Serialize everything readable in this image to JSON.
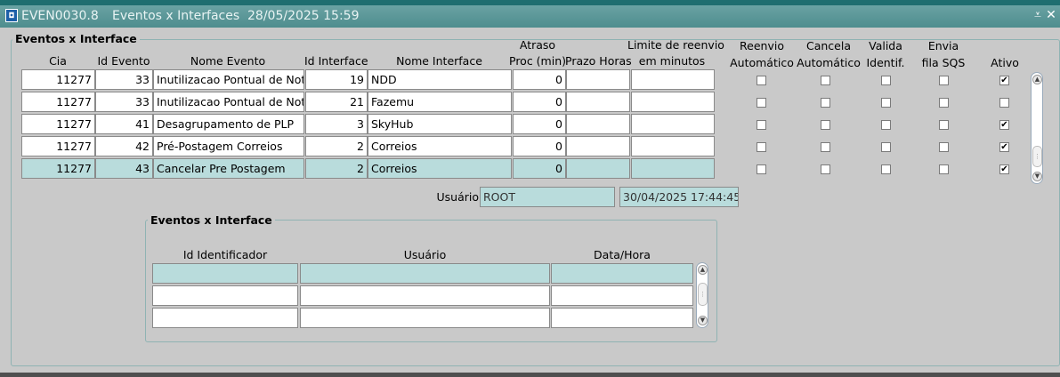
{
  "window": {
    "icon": "form-icon",
    "form_id": "EVEN0030.8",
    "title": "Eventos x Interfaces",
    "datetime": "28/05/2025 15:59",
    "minimize_label": "⩡",
    "close_label": "✕"
  },
  "main": {
    "title": "Eventos x Interface",
    "headers": {
      "cia": "Cia",
      "id_evento": "Id Evento",
      "nome_evento": "Nome Evento",
      "id_interface": "Id Interface",
      "nome_interface": "Nome Interface",
      "atraso_1": "Atraso",
      "atraso_2": "Proc (min)",
      "prazo": "Prazo Horas",
      "limite_1": "Limite de reenvio",
      "limite_2": "em minutos",
      "reenvio_1": "Reenvio",
      "reenvio_2": "Automático",
      "cancela_1": "Cancela",
      "cancela_2": "Automático",
      "valida_1": "Valida",
      "valida_2": "Identif.",
      "envia_1": "Envia",
      "envia_2": "fila SQS",
      "ativo": "Ativo"
    },
    "rows": [
      {
        "cia": "11277",
        "id_evento": "33",
        "nome_evento": "Inutilizacao Pontual de Nota",
        "id_interface": "19",
        "nome_interface": "NDD",
        "atraso": "0",
        "prazo": "",
        "limite": "",
        "reenvio": false,
        "cancela": false,
        "valida": false,
        "envia": false,
        "ativo": true
      },
      {
        "cia": "11277",
        "id_evento": "33",
        "nome_evento": "Inutilizacao Pontual de Nota",
        "id_interface": "21",
        "nome_interface": "Fazemu",
        "atraso": "0",
        "prazo": "",
        "limite": "",
        "reenvio": false,
        "cancela": false,
        "valida": false,
        "envia": false,
        "ativo": false
      },
      {
        "cia": "11277",
        "id_evento": "41",
        "nome_evento": "Desagrupamento de PLP",
        "id_interface": "3",
        "nome_interface": "SkyHub",
        "atraso": "0",
        "prazo": "",
        "limite": "",
        "reenvio": false,
        "cancela": false,
        "valida": false,
        "envia": false,
        "ativo": true
      },
      {
        "cia": "11277",
        "id_evento": "42",
        "nome_evento": "Pré-Postagem Correios",
        "id_interface": "2",
        "nome_interface": "Correios",
        "atraso": "0",
        "prazo": "",
        "limite": "",
        "reenvio": false,
        "cancela": false,
        "valida": false,
        "envia": false,
        "ativo": true
      },
      {
        "cia": "11277",
        "id_evento": "43",
        "nome_evento": "Cancelar Pre Postagem",
        "id_interface": "2",
        "nome_interface": "Correios",
        "atraso": "0",
        "prazo": "",
        "limite": "",
        "reenvio": false,
        "cancela": false,
        "valida": false,
        "envia": false,
        "ativo": true,
        "selected": true
      }
    ],
    "usuario_label": "Usuário",
    "usuario_value": "ROOT",
    "usuario_datetime": "30/04/2025 17:44:45"
  },
  "detail": {
    "title": "Eventos x Interface",
    "headers": {
      "id_identificador": "Id Identificador",
      "usuario": "Usuário",
      "data_hora": "Data/Hora"
    },
    "rows": [
      {
        "id_identificador": "",
        "usuario": "",
        "data_hora": "",
        "selected": true
      },
      {
        "id_identificador": "",
        "usuario": "",
        "data_hora": ""
      },
      {
        "id_identificador": "",
        "usuario": "",
        "data_hora": ""
      }
    ]
  },
  "icons": {
    "scroll_up": "▲",
    "scroll_down": "▼",
    "scroll_grip": "⋮",
    "check": "✔"
  },
  "colors": {
    "titlebar": "#5a9697",
    "selected_row": "#b9dcdc",
    "background": "#c9c9c9"
  }
}
